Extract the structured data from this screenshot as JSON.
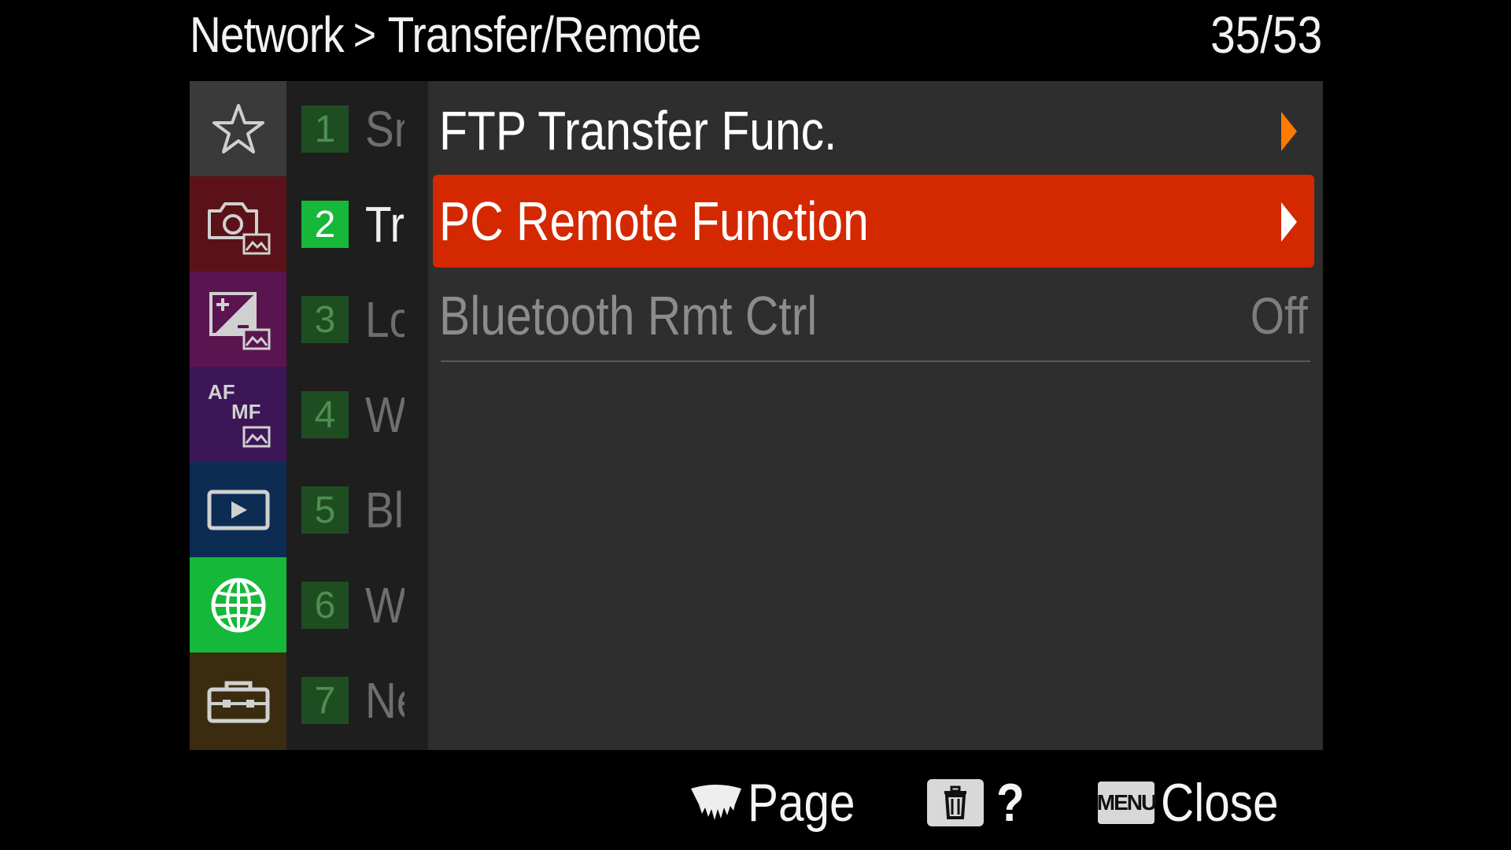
{
  "header": {
    "breadcrumb_parent": "Network",
    "breadcrumb_separator": ">",
    "breadcrumb_current": "Transfer/Remote",
    "page_counter": "35/53"
  },
  "categories": [
    {
      "name": "star-icon",
      "color": "#3a3a3a",
      "active": false
    },
    {
      "name": "camera-photo-icon",
      "color": "#5a1218",
      "active": false
    },
    {
      "name": "exposure-photo-icon",
      "color": "#5a1550",
      "active": false
    },
    {
      "name": "af-mf-photo-icon",
      "color": "#3c1656",
      "active": false,
      "af_text": "AF",
      "mf_text": "MF"
    },
    {
      "name": "playback-icon",
      "color": "#0d2c54",
      "active": false
    },
    {
      "name": "network-globe-icon",
      "color": "#16b83a",
      "active": true
    },
    {
      "name": "setup-toolbox-icon",
      "color": "#3b2c10",
      "active": false
    }
  ],
  "pages": [
    {
      "number": "1",
      "label": "Sn",
      "active": false
    },
    {
      "number": "2",
      "label": "Tr",
      "active": true
    },
    {
      "number": "3",
      "label": "Lo",
      "active": false
    },
    {
      "number": "4",
      "label": "W",
      "active": false
    },
    {
      "number": "5",
      "label": "Bl",
      "active": false
    },
    {
      "number": "6",
      "label": "W",
      "active": false
    },
    {
      "number": "7",
      "label": "Ne",
      "active": false
    }
  ],
  "items": [
    {
      "label": "FTP Transfer Func.",
      "has_submenu": true,
      "selected": false
    },
    {
      "label": "PC Remote Function",
      "has_submenu": true,
      "selected": true
    },
    {
      "label": "Bluetooth Rmt Ctrl",
      "value": "Off",
      "selected": false,
      "disabled": true
    }
  ],
  "footer": {
    "page_label": "Page",
    "help_label": "?",
    "menu_button_text": "MENU",
    "close_label": "Close"
  },
  "colors": {
    "selected_item": "#d42800",
    "active_badge": "#16b83a",
    "submenu_arrow": "#ff7a00"
  }
}
